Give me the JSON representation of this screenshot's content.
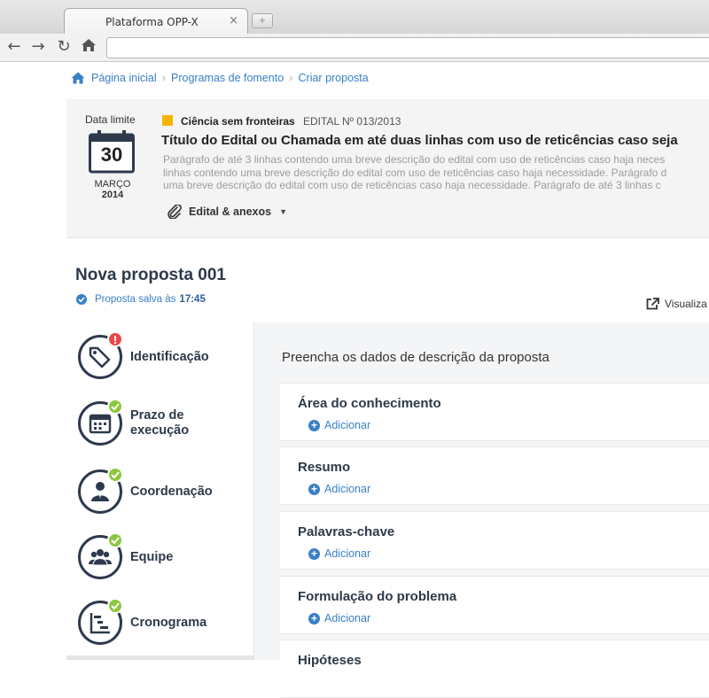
{
  "browser": {
    "tab_title": "Plataforma OPP-X",
    "tab_close": "×",
    "new_tab": "+",
    "url": "",
    "back": "←",
    "forward": "→",
    "reload": "↻"
  },
  "breadcrumb": {
    "items": [
      "Página inicial",
      "Programas de fomento",
      "Criar proposta"
    ],
    "separator": "›"
  },
  "edital": {
    "deadline_label": "Data limite",
    "day": "30",
    "month": "MARÇO",
    "year": "2014",
    "program_color": "#f7b500",
    "program": "Ciência sem fronteiras",
    "number": "EDITAL Nº 013/2013",
    "title": "Título do Edital ou Chamada em até duas linhas com uso de reticências caso seja",
    "description_lines": [
      "Parágrafo de até 3 linhas contendo uma breve descrição do edital com uso de reticências caso haja neces",
      "linhas contendo uma breve descrição do edital com uso de reticências caso haja necessidade. Parágrafo d",
      "uma breve descrição do edital com uso de reticências caso haja necessidade. Parágrafo de até 3 linhas c"
    ],
    "attachments_label": "Edital & anexos",
    "attachments_caret": "▼"
  },
  "proposal": {
    "title": "Nova proposta 001",
    "saved_prefix": "Proposta salva às",
    "saved_time": "17:45",
    "visualize": "Visualiza"
  },
  "steps": [
    {
      "label": "Identificação",
      "icon": "tag-icon",
      "status": "warning"
    },
    {
      "label": "Prazo de execução",
      "icon": "calendar-icon",
      "status": "ok"
    },
    {
      "label": "Coordenação",
      "icon": "person-icon",
      "status": "ok"
    },
    {
      "label": "Equipe",
      "icon": "team-icon",
      "status": "ok"
    },
    {
      "label": "Cronograma",
      "icon": "gantt-icon",
      "status": "ok"
    }
  ],
  "form": {
    "intro": "Preencha os dados de descrição da proposta",
    "add_label": "Adicionar",
    "fields": [
      {
        "title": "Área do conhecimento"
      },
      {
        "title": "Resumo"
      },
      {
        "title": "Palavras-chave"
      },
      {
        "title": "Formulação do problema"
      },
      {
        "title": "Hipóteses"
      }
    ]
  },
  "colors": {
    "link": "#3a80c4",
    "dark": "#2c3949",
    "ok": "#8dc63f",
    "warning": "#e84848"
  }
}
